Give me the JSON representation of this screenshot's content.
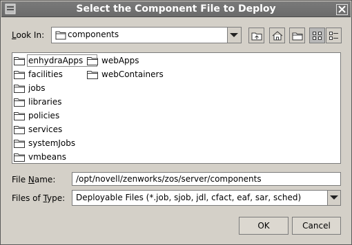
{
  "window": {
    "title": "Select the Component File to Deploy"
  },
  "look_in": {
    "label": "Look In:",
    "label_key": "L",
    "label_rest": "ook In:",
    "value": "components"
  },
  "files": {
    "items": [
      {
        "name": "enhydraApps",
        "selected": true
      },
      {
        "name": "facilities"
      },
      {
        "name": "jobs"
      },
      {
        "name": "libraries"
      },
      {
        "name": "policies"
      },
      {
        "name": "services"
      },
      {
        "name": "systemJobs"
      },
      {
        "name": "vmbeans"
      },
      {
        "name": "webApps"
      },
      {
        "name": "webContainers"
      }
    ]
  },
  "file_name": {
    "label_pre": "File ",
    "label_key": "N",
    "label_post": "ame:",
    "value": "/opt/novell/zenworks/zos/server/components"
  },
  "file_type": {
    "label_pre": "Files of ",
    "label_key": "T",
    "label_post": "ype:",
    "value": "Deployable Files (*.job, sjob, jdl, cfact, eaf, sar, sched)"
  },
  "buttons": {
    "ok": "OK",
    "cancel": "Cancel"
  }
}
